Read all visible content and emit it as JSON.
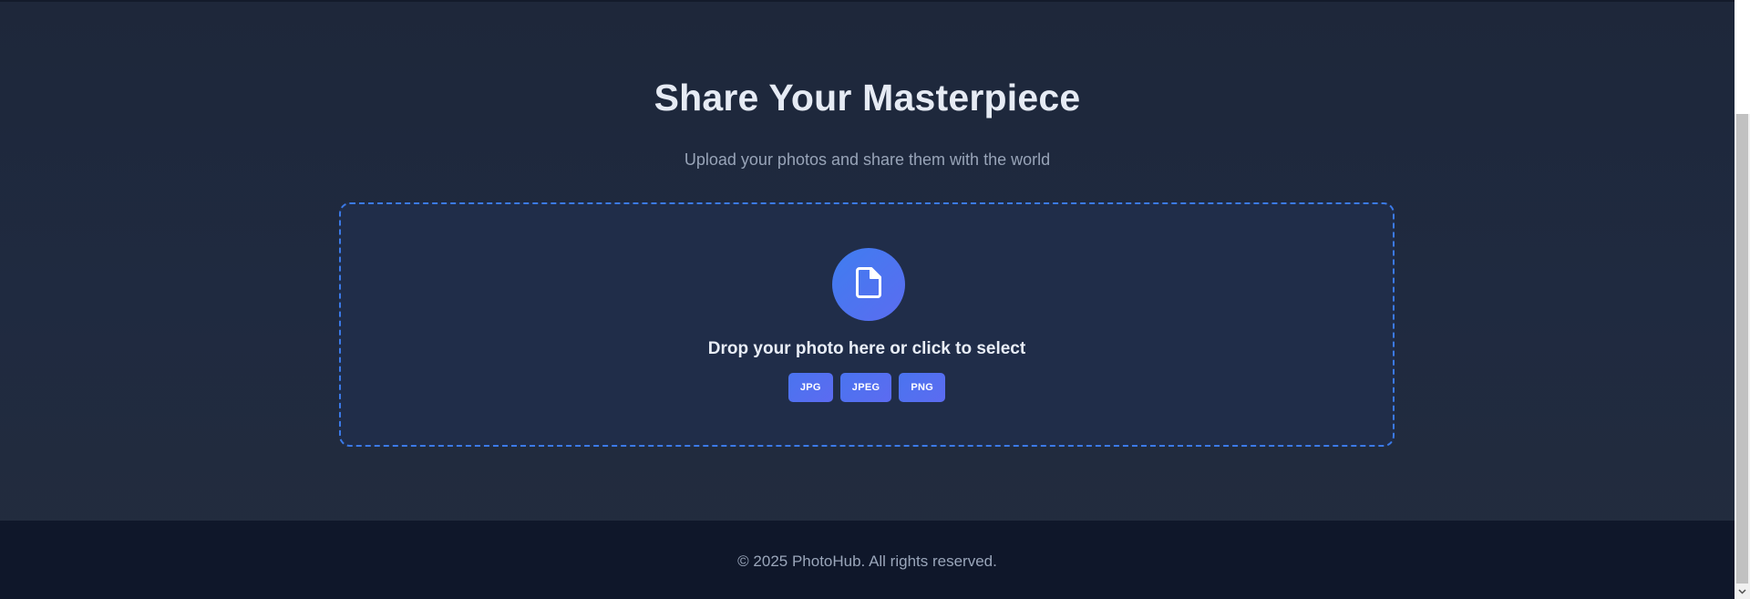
{
  "header": {
    "title": "Share Your Masterpiece",
    "subtitle": "Upload your photos and share them with the world"
  },
  "upload": {
    "icon": "file-icon",
    "prompt": "Drop your photo here or click to select",
    "formats": [
      "JPG",
      "JPEG",
      "PNG"
    ]
  },
  "footer": {
    "text": "© 2025 PhotoHub. All rights reserved."
  },
  "colors": {
    "background": "#1f2a40",
    "accent": "#3b7ae8",
    "badge": "#4f6ef0",
    "footer_bg": "#0f172a"
  }
}
